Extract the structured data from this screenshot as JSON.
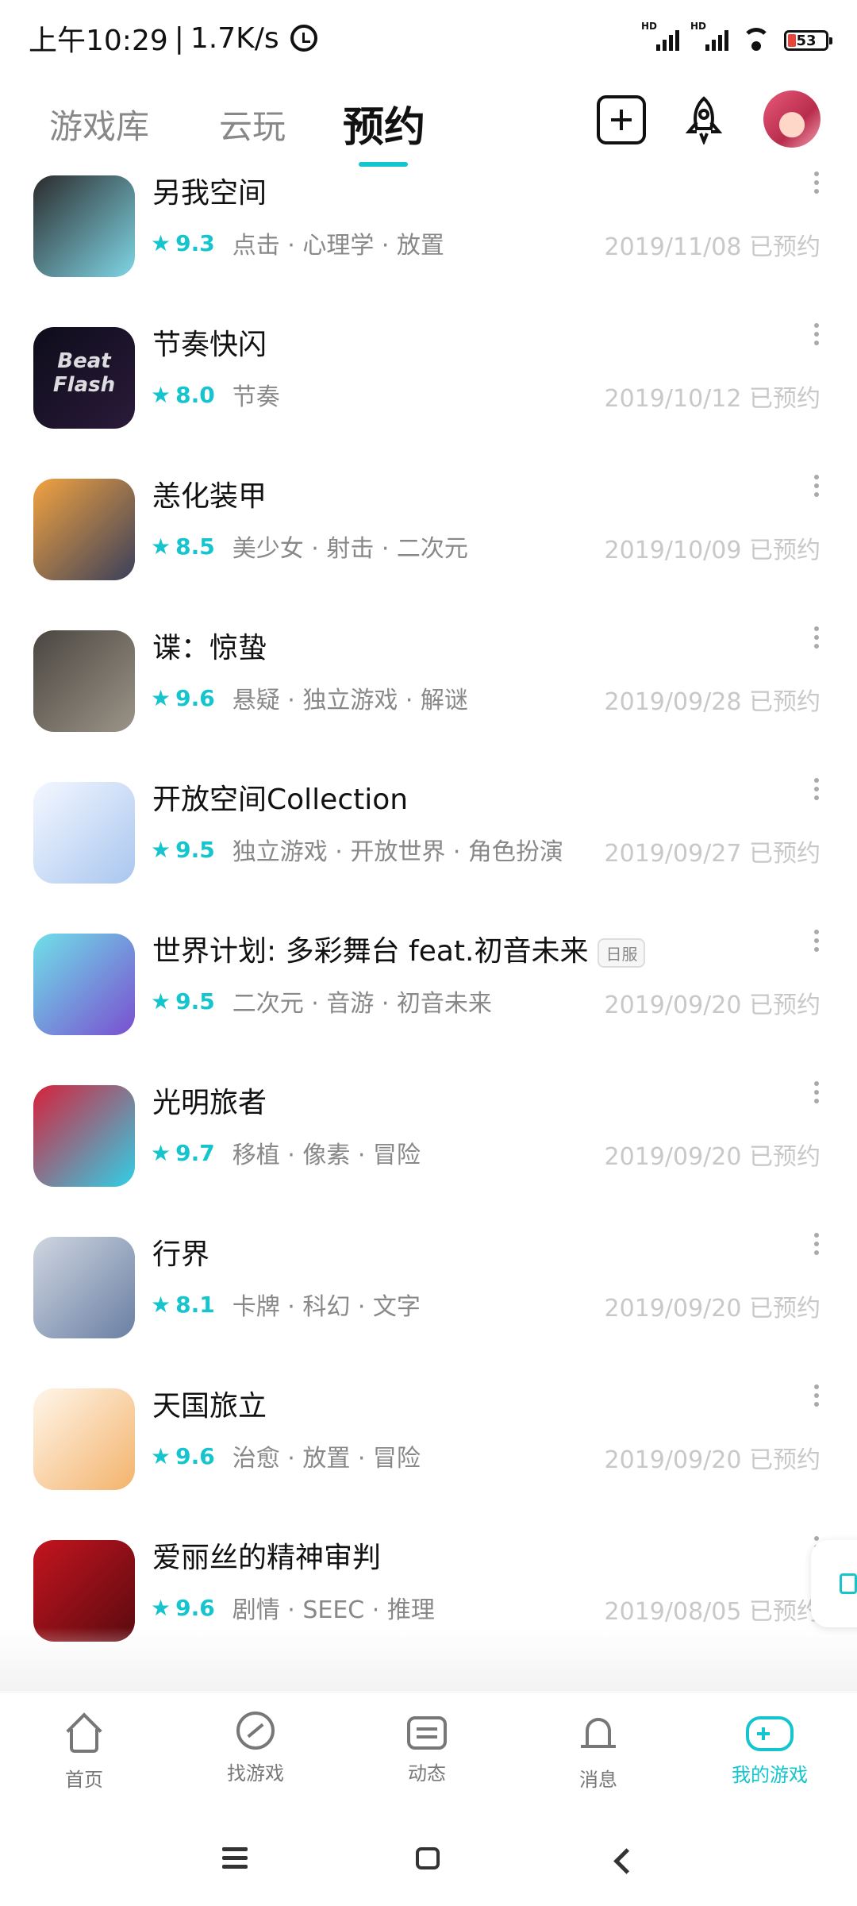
{
  "status_bar": {
    "time": "上午10:29",
    "net_speed": "1.7K/s",
    "battery": "53",
    "signal_label": "HD"
  },
  "header": {
    "tabs": [
      {
        "label": "游戏库"
      },
      {
        "label": "云玩"
      },
      {
        "label": "预约"
      }
    ]
  },
  "games": [
    {
      "title": "另我空间",
      "score": "9.3",
      "tags": "点击 · 心理学 · 放置",
      "date": "2019/11/08 已预约",
      "color1": "#2b2b2b",
      "color2": "#7fd6e6"
    },
    {
      "title": "节奏快闪",
      "score": "8.0",
      "tags": "节奏",
      "date": "2019/10/12 已预约",
      "color1": "#0d0d1a",
      "color2": "#2a1a3a",
      "icon_text": "Beat Flash"
    },
    {
      "title": "恙化装甲",
      "score": "8.5",
      "tags": "美少女 · 射击 · 二次元",
      "date": "2019/10/09 已预约",
      "color1": "#f3a340",
      "color2": "#3a3f5a"
    },
    {
      "title": "谍：惊蛰",
      "score": "9.6",
      "tags": "悬疑 · 独立游戏 · 解谜",
      "date": "2019/09/28 已预约",
      "color1": "#4a4640",
      "color2": "#9c9488"
    },
    {
      "title": "开放空间Collection",
      "score": "9.5",
      "tags": "独立游戏 · 开放世界 · 角色扮演",
      "date": "2019/09/27 已预约",
      "color1": "#f4f8ff",
      "color2": "#a9c6ef"
    },
    {
      "title": "世界计划: 多彩舞台 feat.初音未来",
      "server_tag": "日服",
      "score": "9.5",
      "tags": "二次元 · 音游 · 初音未来",
      "date": "2019/09/20 已预约",
      "color1": "#6fe0e8",
      "color2": "#7a4fd0"
    },
    {
      "title": "光明旅者",
      "score": "9.7",
      "tags": "移植 · 像素 · 冒险",
      "date": "2019/09/20 已预约",
      "color1": "#d8203a",
      "color2": "#2fd0e8"
    },
    {
      "title": "行界",
      "score": "8.1",
      "tags": "卡牌 · 科幻 · 文字",
      "date": "2019/09/20 已预约",
      "color1": "#cfd6e0",
      "color2": "#6a7fa4"
    },
    {
      "title": "天国旅立",
      "score": "9.6",
      "tags": "治愈 · 放置 · 冒险",
      "date": "2019/09/20 已预约",
      "color1": "#fff6ea",
      "color2": "#f3b36c"
    },
    {
      "title": "爱丽丝的精神审判",
      "score": "9.6",
      "tags": "剧情 · SEEC · 推理",
      "date": "2019/08/05 已预约",
      "color1": "#c4141e",
      "color2": "#5a0a10"
    }
  ],
  "bottom_nav": [
    {
      "label": "首页",
      "icon": "home-icon"
    },
    {
      "label": "找游戏",
      "icon": "discover-icon"
    },
    {
      "label": "动态",
      "icon": "feed-icon"
    },
    {
      "label": "消息",
      "icon": "bell-icon"
    },
    {
      "label": "我的游戏",
      "icon": "gamepad-icon",
      "active": true
    }
  ],
  "colors": {
    "accent": "#15c5ce",
    "muted_text": "#888888",
    "date_text": "#c8c8c8"
  }
}
